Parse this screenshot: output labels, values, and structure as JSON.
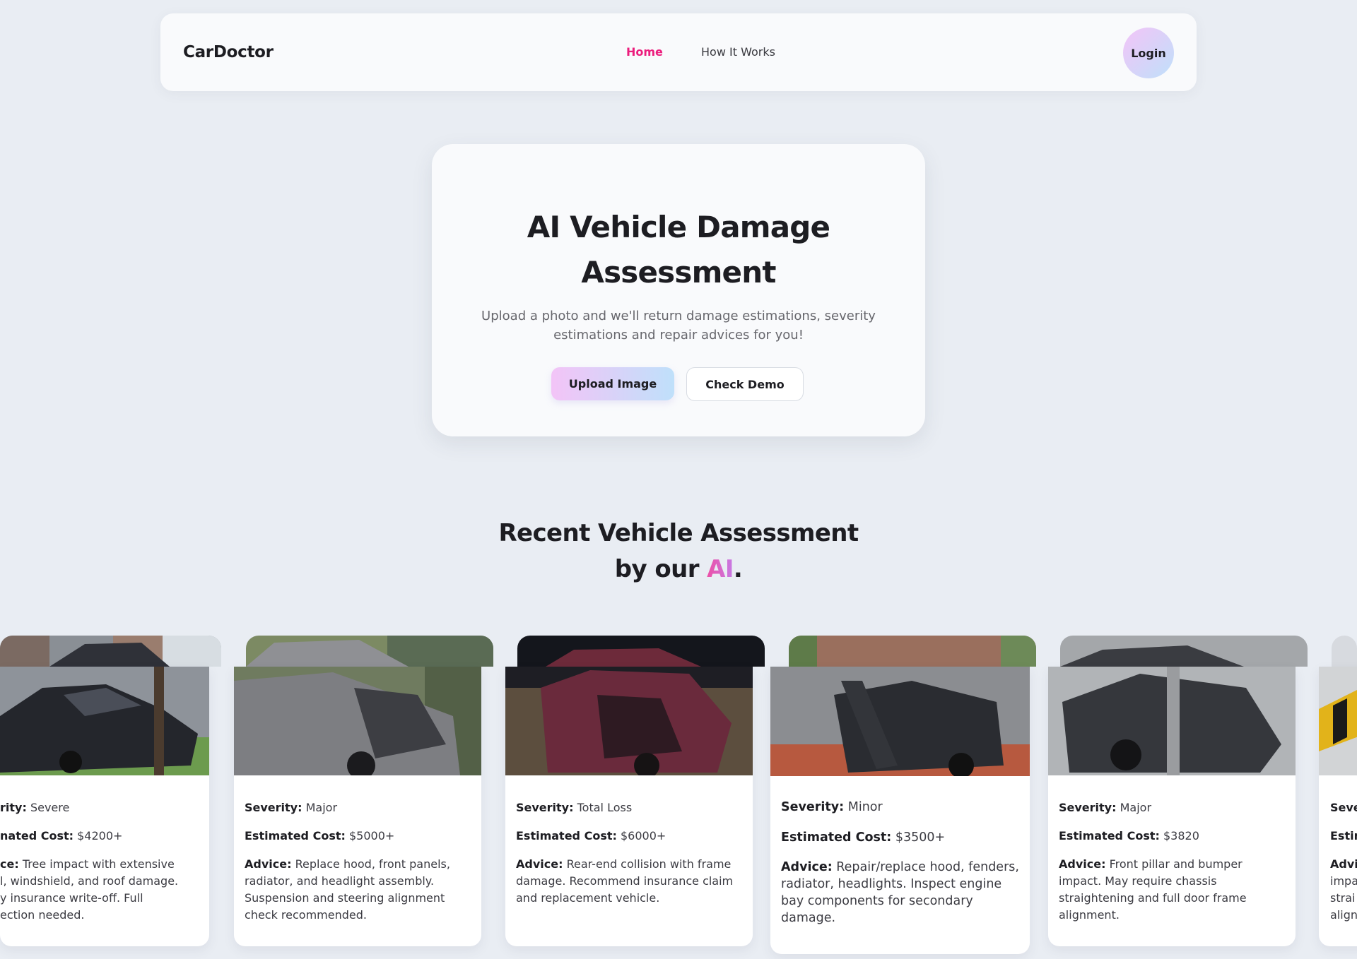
{
  "navbar": {
    "brand": "CarDoctor",
    "links": [
      {
        "label": "Home",
        "active": true
      },
      {
        "label": "How It Works",
        "active": false
      }
    ],
    "login_label": "Login",
    "active_color": "#ec1d7d"
  },
  "hero": {
    "title": "AI Vehicle Damage Assessment",
    "subtitle": "Upload a photo and we'll return damage estimations, severity estimations and repair advices for you!",
    "upload_label": "Upload Image",
    "demo_label": "Check Demo"
  },
  "recent": {
    "title_line1": "Recent Vehicle Assessment",
    "title_line2_prefix": "by our ",
    "title_highlight": "AI",
    "title_suffix": "."
  },
  "labels": {
    "severity": "Severity:",
    "cost": "Estimated Cost:",
    "advice": "Advice:"
  },
  "cards": [
    {
      "severity": "Severe",
      "cost": "$4200+",
      "advice": "Tree impact with extensive hood, windshield, and roof damage. Likely insurance write-off. Full inspection needed.",
      "severity_visible": "rity:",
      "cost_label_visible": "nated Cost:",
      "advice_label_visible": "ce:",
      "advice_visible_lines": [
        "Tree impact with extensive",
        "l, windshield, and roof damage.",
        "y insurance write-off. Full",
        "ection needed."
      ]
    },
    {
      "severity": "Major",
      "cost": "$5000+",
      "advice": "Replace hood, front panels, radiator, and headlight assembly. Suspension and steering alignment check recommended."
    },
    {
      "severity": "Total Loss",
      "cost": "$6000+",
      "advice": "Rear-end collision with frame damage. Recommend insurance claim and replacement vehicle."
    },
    {
      "severity": "Minor",
      "cost": "$3500+",
      "advice": "Repair/replace hood, fenders, radiator, headlights. Inspect engine bay components for secondary damage."
    },
    {
      "severity": "Major",
      "cost": "$3820",
      "advice": "Front pillar and bumper impact. May require chassis straightening and full door frame alignment."
    },
    {
      "labels_visible": [
        "Seve",
        "Estin",
        "Advi"
      ],
      "advice_visible_lines": [
        "impa",
        "strai",
        "align"
      ]
    }
  ]
}
